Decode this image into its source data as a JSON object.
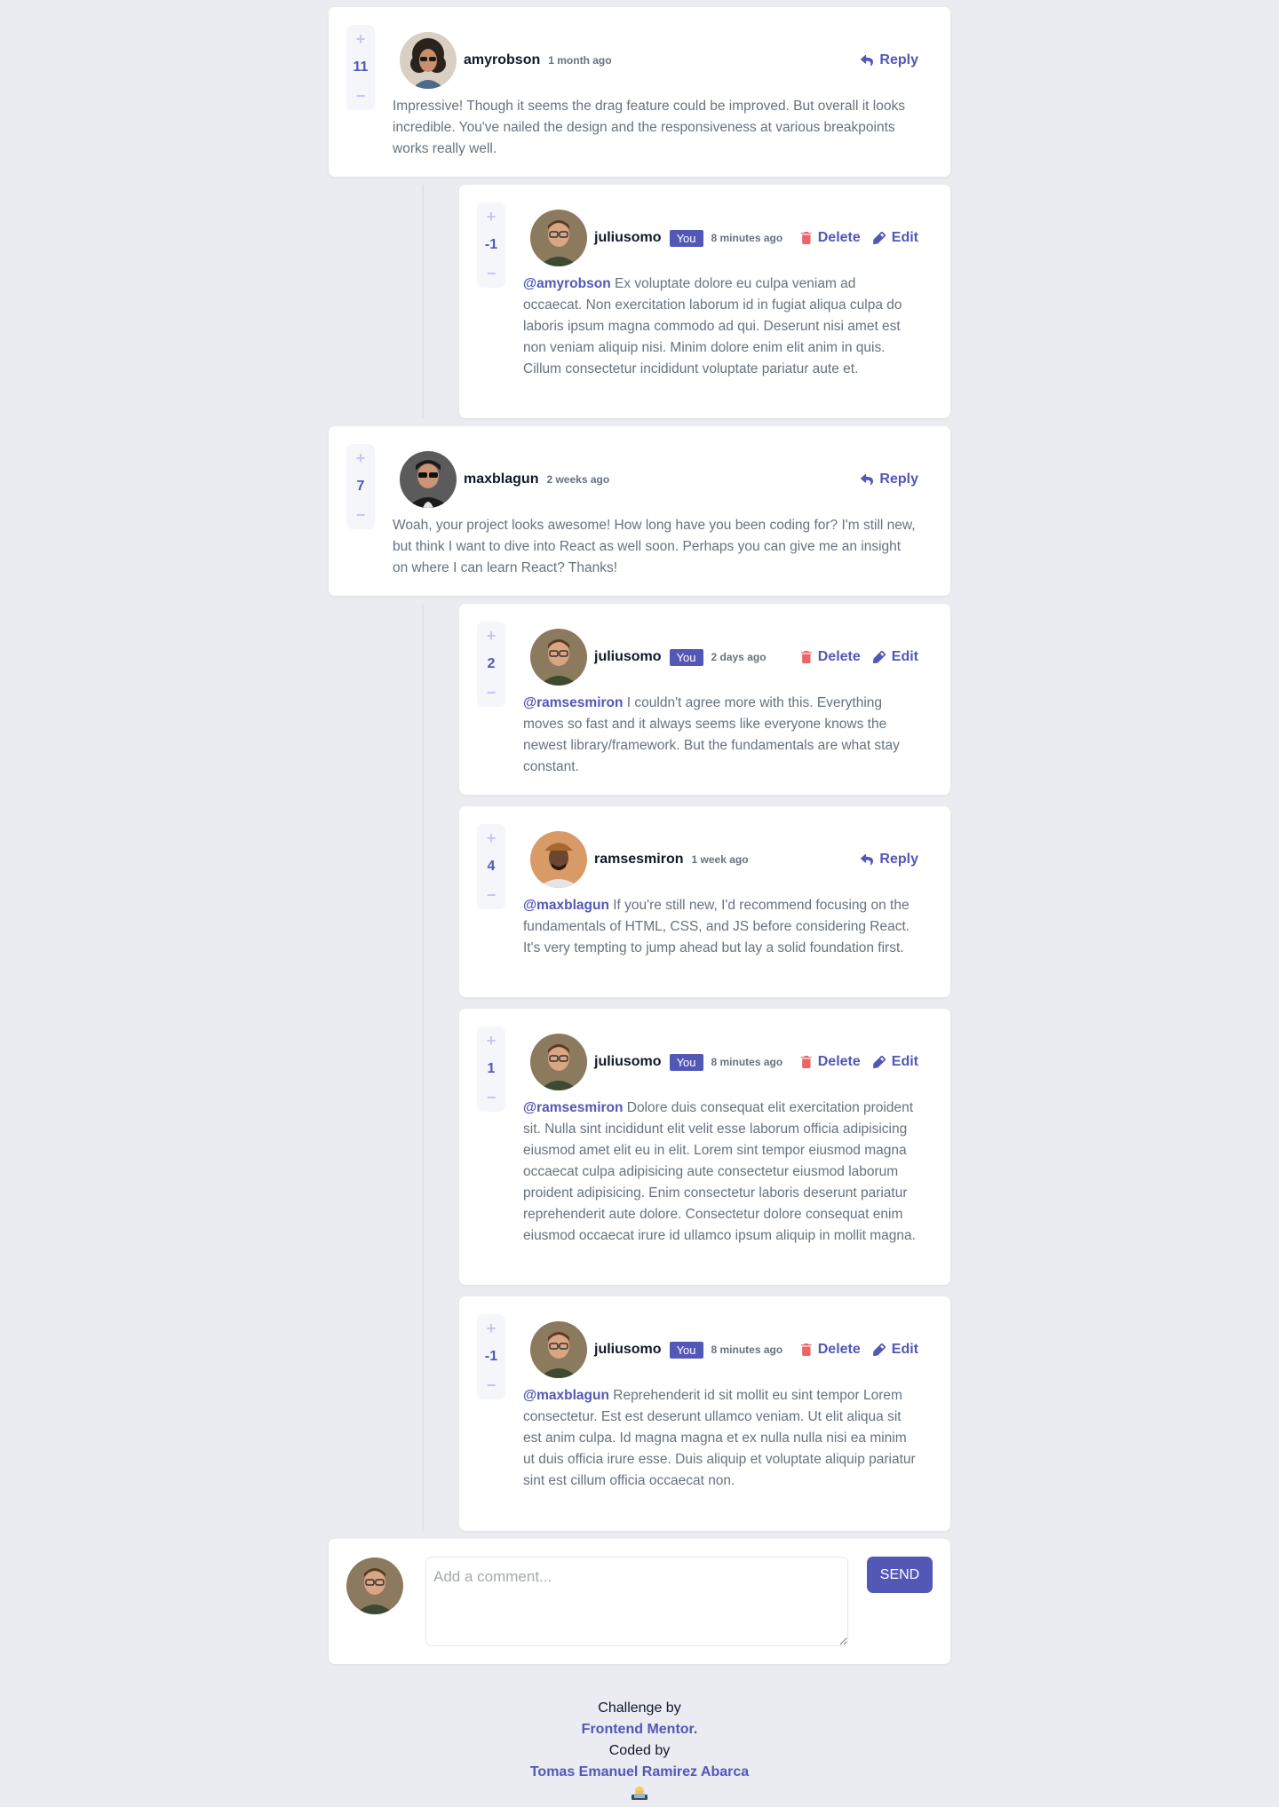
{
  "labels": {
    "reply": "Reply",
    "delete": "Delete",
    "edit": "Edit",
    "you": "You",
    "upvote": "+",
    "downvote": "−"
  },
  "comments": [
    {
      "user": "amyrobson",
      "when": "1 month ago",
      "score": "11",
      "mention": "",
      "text": "Impressive! Though it seems the drag feature could be improved. But overall it looks incredible. You've nailed the design and the responsiveness at various breakpoints works really well."
    },
    {
      "user": "juliusomo",
      "when": "8 minutes ago",
      "score": "-1",
      "mention": "@amyrobson",
      "text": "Ex voluptate dolore eu culpa veniam ad occaecat. Non exercitation laborum id in fugiat aliqua culpa do laboris ipsum magna commodo ad qui. Deserunt nisi amet est non veniam aliquip nisi. Minim dolore enim elit anim in quis. Cillum consectetur incididunt voluptate pariatur aute et."
    },
    {
      "user": "maxblagun",
      "when": "2 weeks ago",
      "score": "7",
      "mention": "",
      "text": "Woah, your project looks awesome! How long have you been coding for? I'm still new, but think I want to dive into React as well soon. Perhaps you can give me an insight on where I can learn React? Thanks!"
    },
    {
      "user": "juliusomo",
      "when": "2 days ago",
      "score": "2",
      "mention": "@ramsesmiron",
      "text": "I couldn't agree more with this. Everything moves so fast and it always seems like everyone knows the newest library/framework. But the fundamentals are what stay constant."
    },
    {
      "user": "ramsesmiron",
      "when": "1 week ago",
      "score": "4",
      "mention": "@maxblagun",
      "text": "If you're still new, I'd recommend focusing on the fundamentals of HTML, CSS, and JS before considering React. It's very tempting to jump ahead but lay a solid foundation first."
    },
    {
      "user": "juliusomo",
      "when": "8 minutes ago",
      "score": "1",
      "mention": "@ramsesmiron",
      "text": "Dolore duis consequat elit exercitation proident sit. Nulla sint incididunt elit velit esse laborum officia adipisicing eiusmod amet elit eu in elit. Lorem sint tempor eiusmod magna occaecat culpa adipisicing aute consectetur eiusmod laborum proident adipisicing. Enim consectetur laboris deserunt pariatur reprehenderit aute dolore. Consectetur dolore consequat enim eiusmod occaecat irure id ullamco ipsum aliquip in mollit magna."
    },
    {
      "user": "juliusomo",
      "when": "8 minutes ago",
      "score": "-1",
      "mention": "@maxblagun",
      "text": "Reprehenderit id sit mollit eu sint tempor Lorem consectetur. Est est deserunt ullamco veniam. Ut elit aliqua sit est anim culpa. Id magna magna et ex nulla nulla nisi ea minim ut duis officia irure esse. Duis aliquip et voluptate aliquip pariatur sint est cillum officia occaecat non."
    }
  ],
  "composer": {
    "placeholder": "Add a comment...",
    "send_label": "SEND"
  },
  "footer": {
    "challenge_by": "Challenge by",
    "challenge_link": "Frontend Mentor.",
    "coded_by": "Coded by",
    "author_link": "Tomas Emanuel Ramirez Abarca"
  },
  "colors": {
    "background": "#eaecf1",
    "primary": "#5357b6",
    "light_primary": "#c5c6ef",
    "danger": "#ed6468",
    "text": "#67727e",
    "heading": "#111827",
    "card": "#ffffff"
  }
}
